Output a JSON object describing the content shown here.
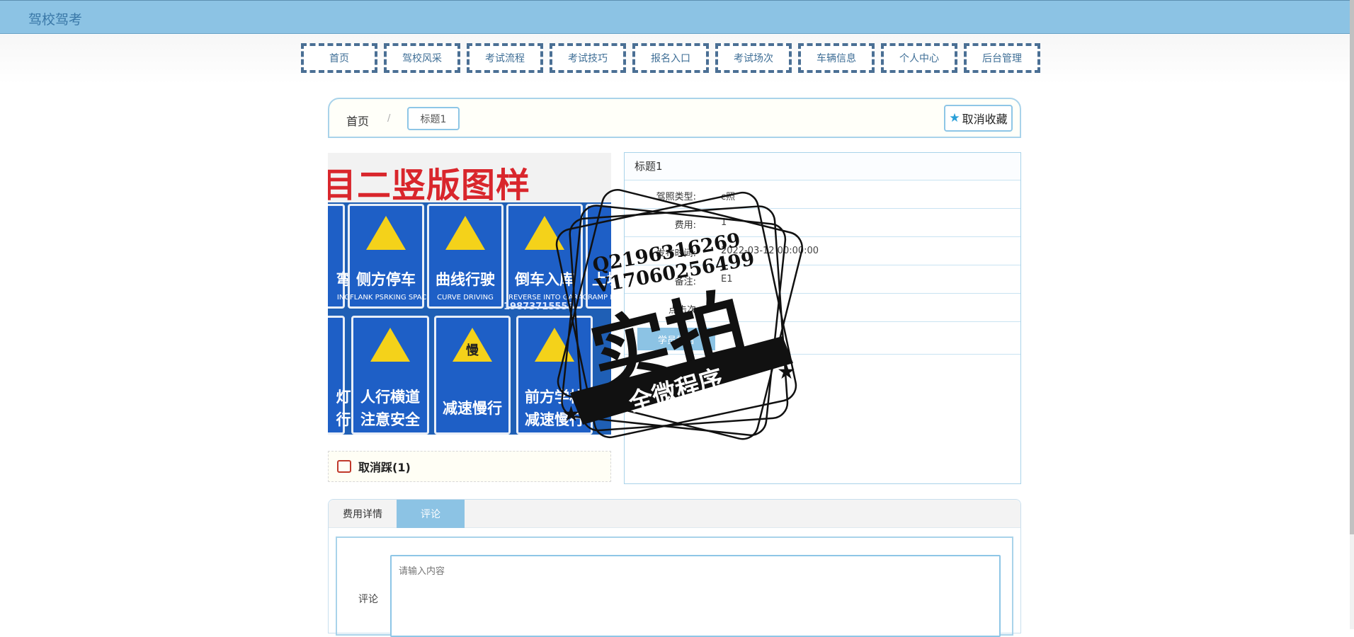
{
  "site": {
    "title": "驾校驾考"
  },
  "nav": {
    "items": [
      {
        "label": "首页"
      },
      {
        "label": "驾校风采"
      },
      {
        "label": "考试流程"
      },
      {
        "label": "考试技巧"
      },
      {
        "label": "报名入口"
      },
      {
        "label": "考试场次"
      },
      {
        "label": "车辆信息"
      },
      {
        "label": "个人中心"
      },
      {
        "label": "后台管理"
      }
    ]
  },
  "breadcrumb": {
    "home": "首页",
    "separator": "/",
    "current": "标题1"
  },
  "favorite": {
    "label": "取消收藏",
    "icon": "star-icon"
  },
  "photo": {
    "header_text": "目二竖版图样",
    "signs": [
      {
        "title": "弯",
        "sub": "ING"
      },
      {
        "title": "侧方停车",
        "sub": "FLANK PSRKING SPACE"
      },
      {
        "title": "曲线行驶",
        "sub": "CURVE DRIVING"
      },
      {
        "title": "倒车入库",
        "sub": "REVERSE INTO GARAGE"
      },
      {
        "title": "上坡",
        "sub": "RAMP PARKI"
      },
      {
        "title": "灯",
        "sub": "行"
      },
      {
        "title": "人行横道",
        "sub": "注意安全"
      },
      {
        "title": "减速慢行",
        "sub": "慢"
      },
      {
        "title": "前方学校",
        "sub": "减速慢行"
      }
    ],
    "phone_overlay": "19873715555"
  },
  "dislike": {
    "label": "取消踩(1)",
    "icon": "thumbs-down-icon"
  },
  "info": {
    "title": "标题1",
    "rows": [
      {
        "key": "驾照类型:",
        "value": "c照"
      },
      {
        "key": "费用:",
        "value": "1"
      },
      {
        "key": "发布时间:",
        "value": "2022-03-12 00:00:00"
      },
      {
        "key": "备注:",
        "value": "E1"
      },
      {
        "key": "点击次",
        "value": ""
      }
    ],
    "signup_label": "学员报名"
  },
  "tabs": {
    "items": [
      {
        "label": "费用详情",
        "active": false
      },
      {
        "label": "评论",
        "active": true
      }
    ]
  },
  "comment": {
    "label": "评论",
    "placeholder": "请输入内容"
  },
  "watermark": {
    "line1": "Q2196316269",
    "line2": "V17060256499",
    "main": "实拍",
    "ribbon": "全微程序"
  },
  "colors": {
    "accent": "#8cc3e4",
    "nav_border": "#4a6f94",
    "title_text": "#3a78a8",
    "sign_red": "#d9262c",
    "sign_blue": "#1e5fc6",
    "sign_yellow": "#f4d21a"
  }
}
